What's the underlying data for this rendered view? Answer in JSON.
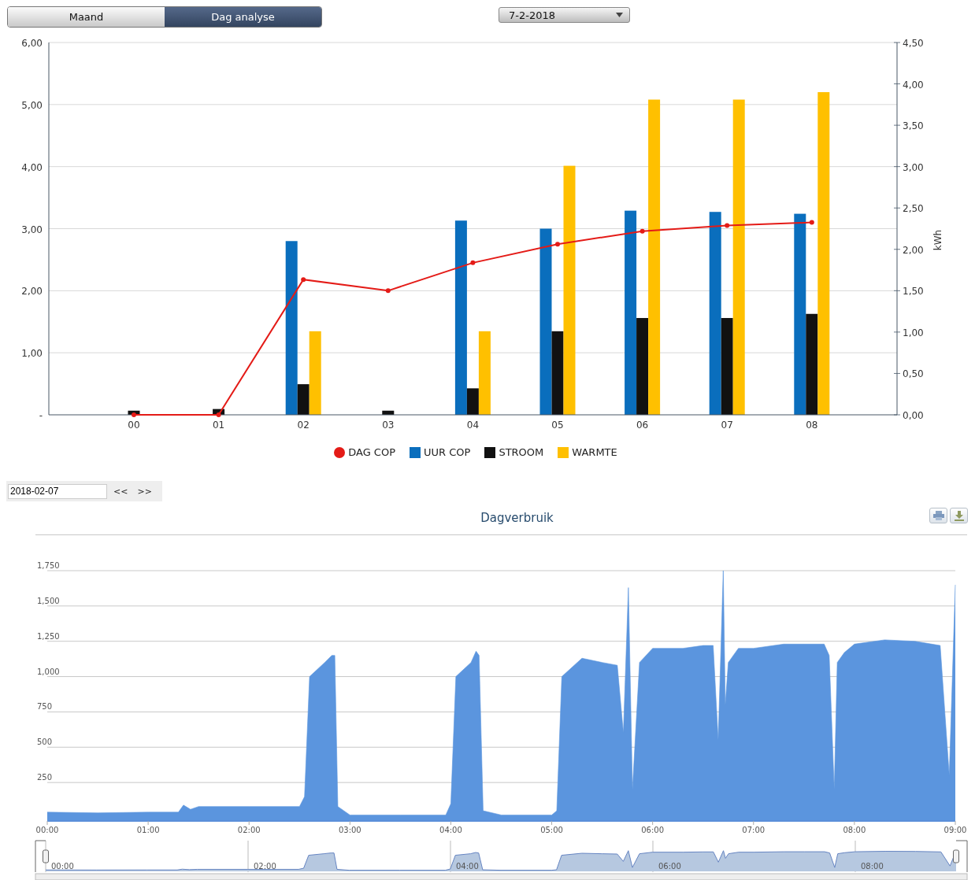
{
  "view_toggle": [
    {
      "label": "Maand",
      "selected": false
    },
    {
      "label": "Dag analyse",
      "selected": true
    }
  ],
  "date_dropdown": {
    "value": "7-2-2018"
  },
  "cop_chart": {
    "chart_data": {
      "type": "bar",
      "categories": [
        "00",
        "01",
        "02",
        "03",
        "04",
        "05",
        "06",
        "07",
        "08"
      ],
      "grid": true,
      "ylim": [
        0,
        6
      ],
      "yticks": [
        {
          "value": 0,
          "label": "-"
        },
        {
          "value": 1,
          "label": "1,00"
        },
        {
          "value": 2,
          "label": "2,00"
        },
        {
          "value": 3,
          "label": "3,00"
        },
        {
          "value": 4,
          "label": "4,00"
        },
        {
          "value": 5,
          "label": "5,00"
        },
        {
          "value": 6,
          "label": "6,00"
        }
      ],
      "y2label": "kWh",
      "y2lim": [
        0,
        4.5
      ],
      "y2ticks": [
        {
          "value": 0,
          "label": "0,00"
        },
        {
          "value": 0.5,
          "label": "0,50"
        },
        {
          "value": 1,
          "label": "1,00"
        },
        {
          "value": 1.5,
          "label": "1,50"
        },
        {
          "value": 2,
          "label": "2,00"
        },
        {
          "value": 2.5,
          "label": "2,50"
        },
        {
          "value": 3,
          "label": "3,00"
        },
        {
          "value": 3.5,
          "label": "3,50"
        },
        {
          "value": 4,
          "label": "4,00"
        },
        {
          "value": 4.5,
          "label": "4,50"
        }
      ],
      "series": [
        {
          "name": "DAG COP",
          "type": "line",
          "marker": true,
          "color": "#e41b17",
          "values": [
            0,
            0,
            2.18,
            2.0,
            2.45,
            2.75,
            2.96,
            3.05,
            3.1
          ]
        },
        {
          "name": "UUR COP",
          "color": "#0a6ebd",
          "values": [
            null,
            null,
            2.8,
            null,
            3.13,
            3.0,
            3.29,
            3.27,
            3.24
          ]
        },
        {
          "name": "STROOM",
          "axis": "y2",
          "color": "#111111",
          "values": [
            0.05,
            0.07,
            0.37,
            0.05,
            0.32,
            1.01,
            1.17,
            1.17,
            1.22
          ]
        },
        {
          "name": "WARMTE",
          "axis": "y2",
          "color": "#ffc000",
          "values": [
            null,
            null,
            1.01,
            null,
            1.01,
            3.01,
            3.81,
            3.81,
            3.9
          ]
        }
      ]
    }
  },
  "date_nav": {
    "value": "2018-02-07",
    "prev": "<<",
    "next": ">>"
  },
  "usage_chart": {
    "title": "Dagverbruik",
    "chart_data": {
      "type": "area",
      "grid": true,
      "xlim": [
        0,
        9
      ],
      "ylim": [
        0,
        1750
      ],
      "xticks": [
        {
          "value": 0,
          "label": "00:00"
        },
        {
          "value": 1,
          "label": "01:00"
        },
        {
          "value": 2,
          "label": "02:00"
        },
        {
          "value": 3,
          "label": "03:00"
        },
        {
          "value": 4,
          "label": "04:00"
        },
        {
          "value": 5,
          "label": "05:00"
        },
        {
          "value": 6,
          "label": "06:00"
        },
        {
          "value": 7,
          "label": "07:00"
        },
        {
          "value": 8,
          "label": "08:00"
        },
        {
          "value": 9,
          "label": "09:00"
        }
      ],
      "yticks": [
        {
          "value": 250,
          "label": "250"
        },
        {
          "value": 500,
          "label": "500"
        },
        {
          "value": 750,
          "label": "750"
        },
        {
          "value": 1000,
          "label": "1,000"
        },
        {
          "value": 1250,
          "label": "1,250"
        },
        {
          "value": 1500,
          "label": "1,500"
        },
        {
          "value": 1750,
          "label": "1,750"
        }
      ],
      "x": [
        0,
        0.5,
        1.0,
        1.3,
        1.35,
        1.42,
        1.5,
        2.0,
        2.5,
        2.55,
        2.6,
        2.75,
        2.82,
        2.85,
        2.88,
        3.0,
        3.5,
        3.95,
        4.0,
        4.05,
        4.2,
        4.25,
        4.28,
        4.32,
        4.5,
        5.0,
        5.05,
        5.1,
        5.3,
        5.5,
        5.65,
        5.71,
        5.76,
        5.8,
        5.87,
        6.0,
        6.3,
        6.5,
        6.6,
        6.65,
        6.7,
        6.72,
        6.75,
        6.85,
        7.0,
        7.3,
        7.5,
        7.7,
        7.75,
        7.8,
        7.83,
        7.9,
        8.0,
        8.3,
        8.6,
        8.85,
        8.94,
        9.0
      ],
      "series": [
        {
          "color": "#5b95de",
          "values": [
            40,
            35,
            40,
            40,
            90,
            60,
            80,
            80,
            80,
            150,
            1000,
            1100,
            1150,
            1150,
            80,
            20,
            20,
            20,
            100,
            1000,
            1100,
            1180,
            1150,
            50,
            20,
            20,
            50,
            1000,
            1130,
            1100,
            1080,
            600,
            1630,
            200,
            1100,
            1200,
            1200,
            1220,
            1220,
            550,
            1750,
            800,
            1100,
            1200,
            1200,
            1230,
            1230,
            1230,
            1150,
            200,
            1100,
            1170,
            1230,
            1260,
            1250,
            1220,
            300,
            1650
          ]
        }
      ]
    },
    "navigator": {
      "labels": [
        "00:00",
        "02:00",
        "04:00",
        "06:00",
        "08:00"
      ]
    }
  }
}
